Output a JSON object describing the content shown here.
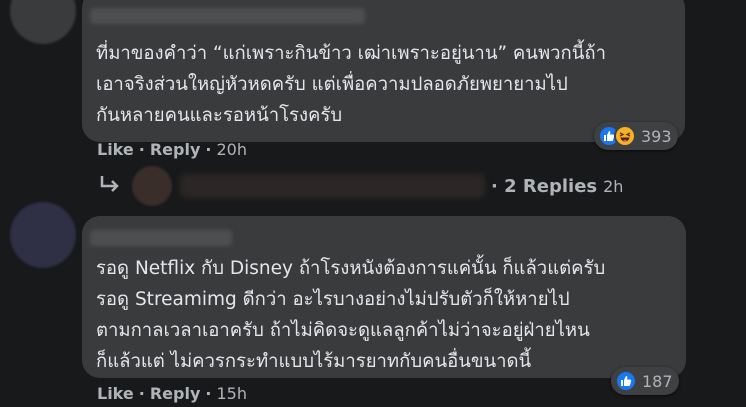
{
  "comments": [
    {
      "lines": [
        "ที่มาของคำว่า “แก่เพราะกินข้าว เฒ่าเพราะอยู่นาน” คนพวกนี้ถ้า",
        "เอาจริงส่วนใหญ่หัวหดครับ แต่เพื่อความปลอดภัยพยายามไป",
        "กันหลายคนและรอหน้าโรงครับ"
      ],
      "reaction_count": "393",
      "like_label": "Like",
      "reply_label": "Reply",
      "time": "20h"
    },
    {
      "lines": [
        "รอดู Netflix กับ Disney ถ้าโรงหนังต้องการแค่นั้น ก็แล้วแต่ครับ",
        "รอดู Streamimg ดีกว่า อะไรบางอย่างไม่ปรับตัวก็ให้หายไป",
        "ตามกาลเวลาเอาครับ ถ้าไม่คิดจะดูแลลูกค้าไม่ว่าจะอยู่ฝ่ายไหน",
        "ก็แล้วแต่ ไม่ควรกระทำแบบไร้มารยาทกับคนอื่นขนาดนี้"
      ],
      "reaction_count": "187",
      "like_label": "Like",
      "reply_label": "Reply",
      "time": "15h"
    }
  ],
  "replies_link": {
    "label": "2 Replies",
    "time": "2h"
  },
  "colors": {
    "background": "#18191a",
    "bubble": "#3a3b3c",
    "text": "#e4e6eb",
    "secondary": "#b0b3b8",
    "like_blue": "#1877f2",
    "haha_yellow": "#f7b125"
  }
}
